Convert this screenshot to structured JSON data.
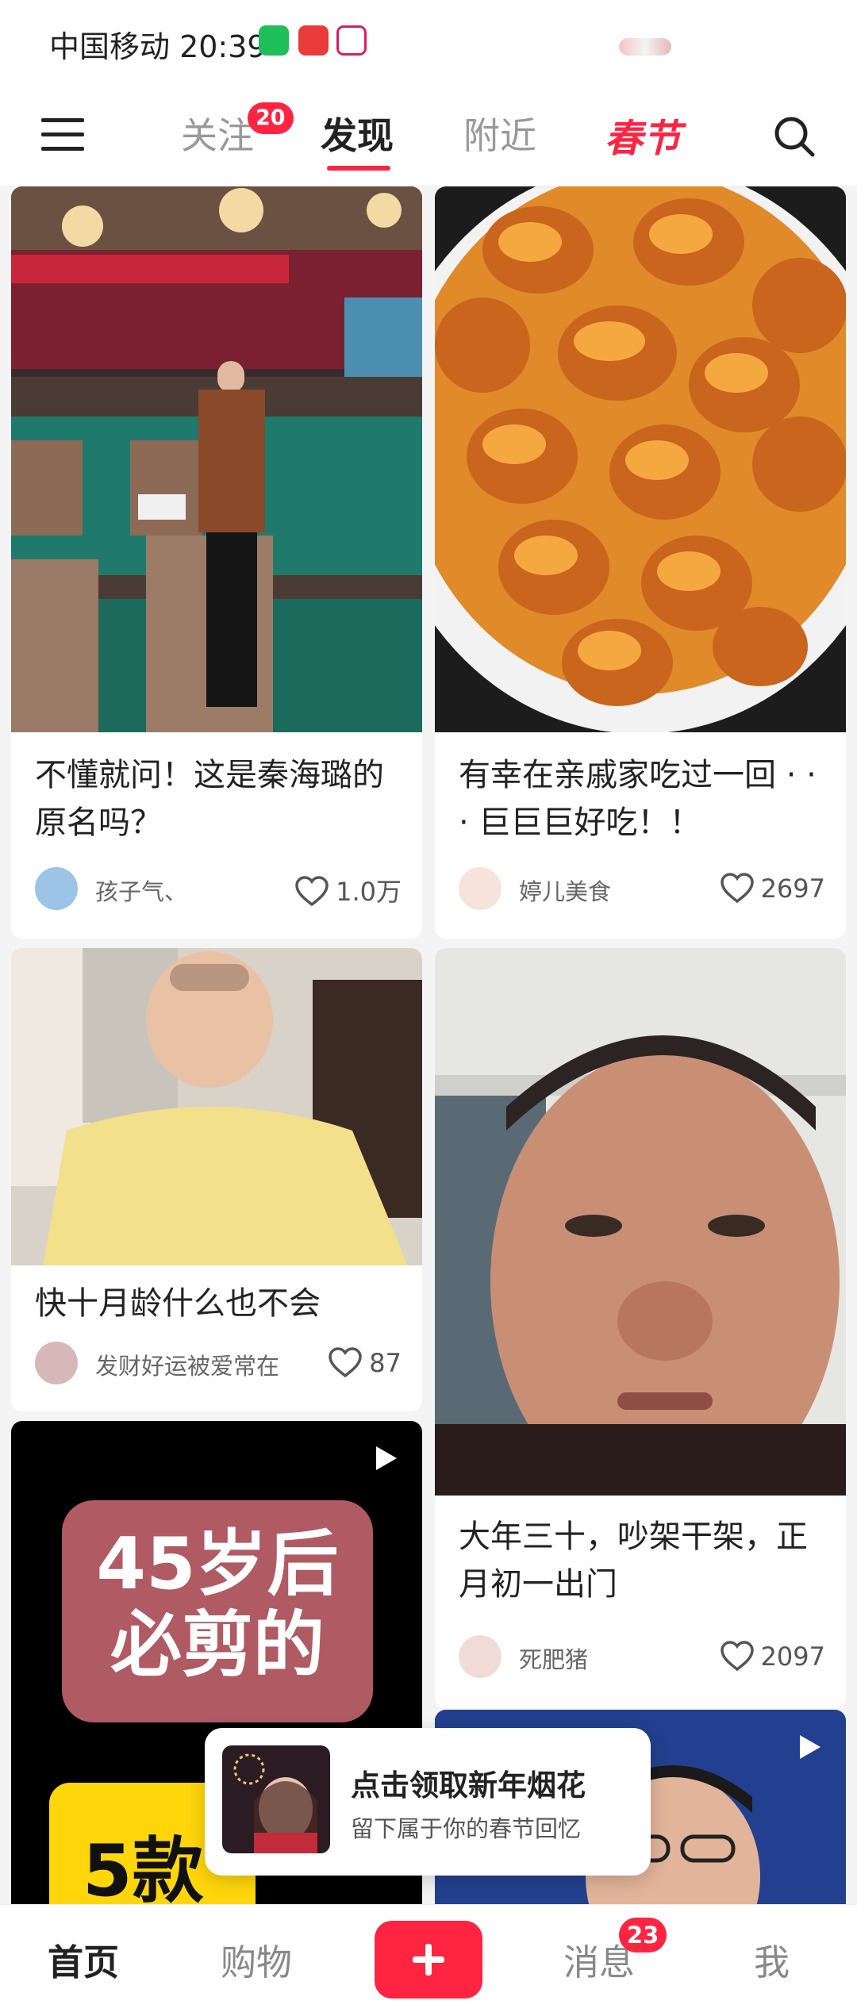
{
  "status_bar": {
    "carrier_time": "中国移动 20:39"
  },
  "top_nav": {
    "tabs": [
      {
        "label": "关注",
        "badge": "20"
      },
      {
        "label": "发现"
      },
      {
        "label": "附近"
      },
      {
        "label": "春节"
      }
    ],
    "active_tab": "发现",
    "icons": {
      "menu": "menu-icon",
      "search": "search-icon"
    }
  },
  "feed": {
    "cards": [
      {
        "title": "不懂就问！这是秦海璐的原名吗？",
        "author": "孩子气、",
        "likes": "1.0万",
        "image": "photo-woman-conference-hall"
      },
      {
        "title": "有幸在亲戚家吃过一回 · · · 巨巨巨好吃！！",
        "author": "婷儿美食",
        "likes": "2697",
        "image": "photo-glazed-fried-food-bowl"
      },
      {
        "title": "快十月龄什么也不会",
        "author": "发财好运被爱常在",
        "likes": "87",
        "image": "photo-baby-yellow-jacket"
      },
      {
        "title": "大年三十，吵架干架，正月初一出门",
        "author": "死肥猪",
        "likes": "2097",
        "image": "photo-crying-man-selfie"
      },
      {
        "video": true,
        "cover_text": "45岁后必剪的",
        "cover_text_2": "5款",
        "image": "video-cover-haircuts"
      },
      {
        "video": true,
        "image": "video-cover-man-glasses"
      }
    ]
  },
  "popup": {
    "title": "点击领取新年烟花",
    "subtitle": "留下属于你的春节回忆"
  },
  "bottom_nav": {
    "items": [
      {
        "label": "首页"
      },
      {
        "label": "购物"
      },
      {
        "label": "消息",
        "badge": "23"
      },
      {
        "label": "我"
      }
    ],
    "add_icon": "plus-icon"
  },
  "colors": {
    "brand_red": "#ff2442",
    "text_primary": "#222222",
    "text_secondary": "#999999",
    "feed_background": "#f4f4f4"
  }
}
